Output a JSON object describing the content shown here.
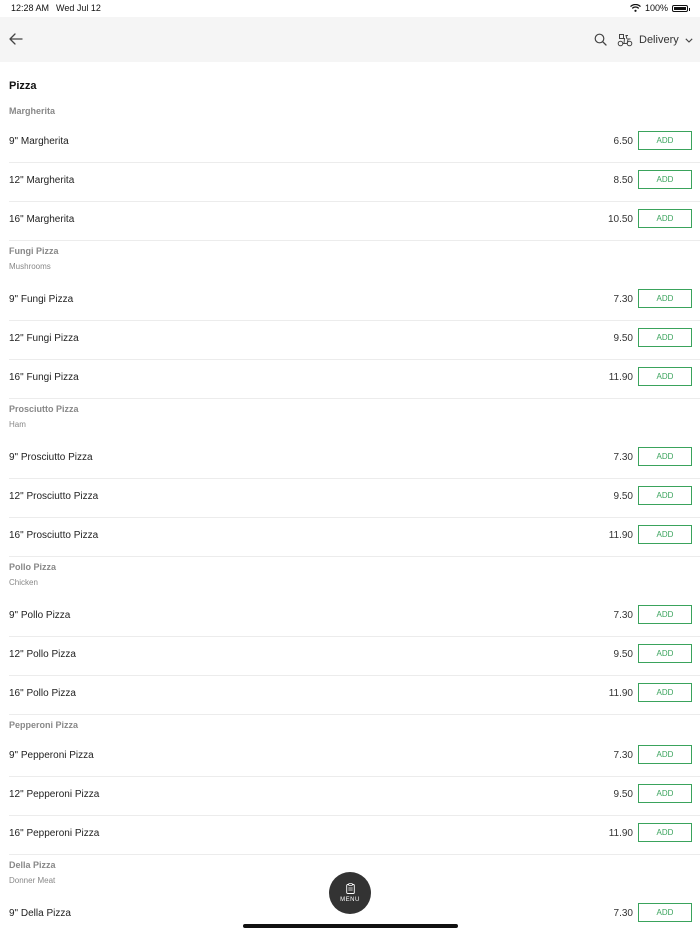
{
  "status_bar": {
    "time": "12:28 AM",
    "date": "Wed Jul 12",
    "battery": "100%"
  },
  "header": {
    "delivery_label": "Delivery"
  },
  "section": {
    "title": "Pizza"
  },
  "groups": [
    {
      "name": "Margherita",
      "description": ""
    },
    {
      "name": "Fungi Pizza",
      "description": "Mushrooms"
    },
    {
      "name": "Prosciutto Pizza",
      "description": "Ham"
    },
    {
      "name": "Pollo Pizza",
      "description": "Chicken"
    },
    {
      "name": "Pepperoni Pizza",
      "description": ""
    },
    {
      "name": "Della Pizza",
      "description": "Donner Meat"
    }
  ],
  "items": [
    {
      "name": "9\" Margherita",
      "price": "6.50"
    },
    {
      "name": "12\" Margherita",
      "price": "8.50"
    },
    {
      "name": "16\" Margherita",
      "price": "10.50"
    },
    {
      "name": "9\" Fungi Pizza",
      "price": "7.30"
    },
    {
      "name": "12\" Fungi Pizza",
      "price": "9.50"
    },
    {
      "name": "16\" Fungi Pizza",
      "price": "11.90"
    },
    {
      "name": "9\" Prosciutto Pizza",
      "price": "7.30"
    },
    {
      "name": "12\" Prosciutto Pizza",
      "price": "9.50"
    },
    {
      "name": "16\" Prosciutto Pizza",
      "price": "11.90"
    },
    {
      "name": "9\" Pollo Pizza",
      "price": "7.30"
    },
    {
      "name": "12\" Pollo Pizza",
      "price": "9.50"
    },
    {
      "name": "16\" Pollo Pizza",
      "price": "11.90"
    },
    {
      "name": "9\" Pepperoni Pizza",
      "price": "7.30"
    },
    {
      "name": "12\" Pepperoni Pizza",
      "price": "9.50"
    },
    {
      "name": "16\" Pepperoni Pizza",
      "price": "11.90"
    },
    {
      "name": "9\" Della Pizza",
      "price": "7.30"
    }
  ],
  "add_label": "ADD",
  "fab": {
    "label": "MENU",
    "icon": "clipboard-icon"
  },
  "colors": {
    "accent": "#3aa35c",
    "header_bg": "#f5f5f5",
    "fab_bg": "#333333"
  }
}
